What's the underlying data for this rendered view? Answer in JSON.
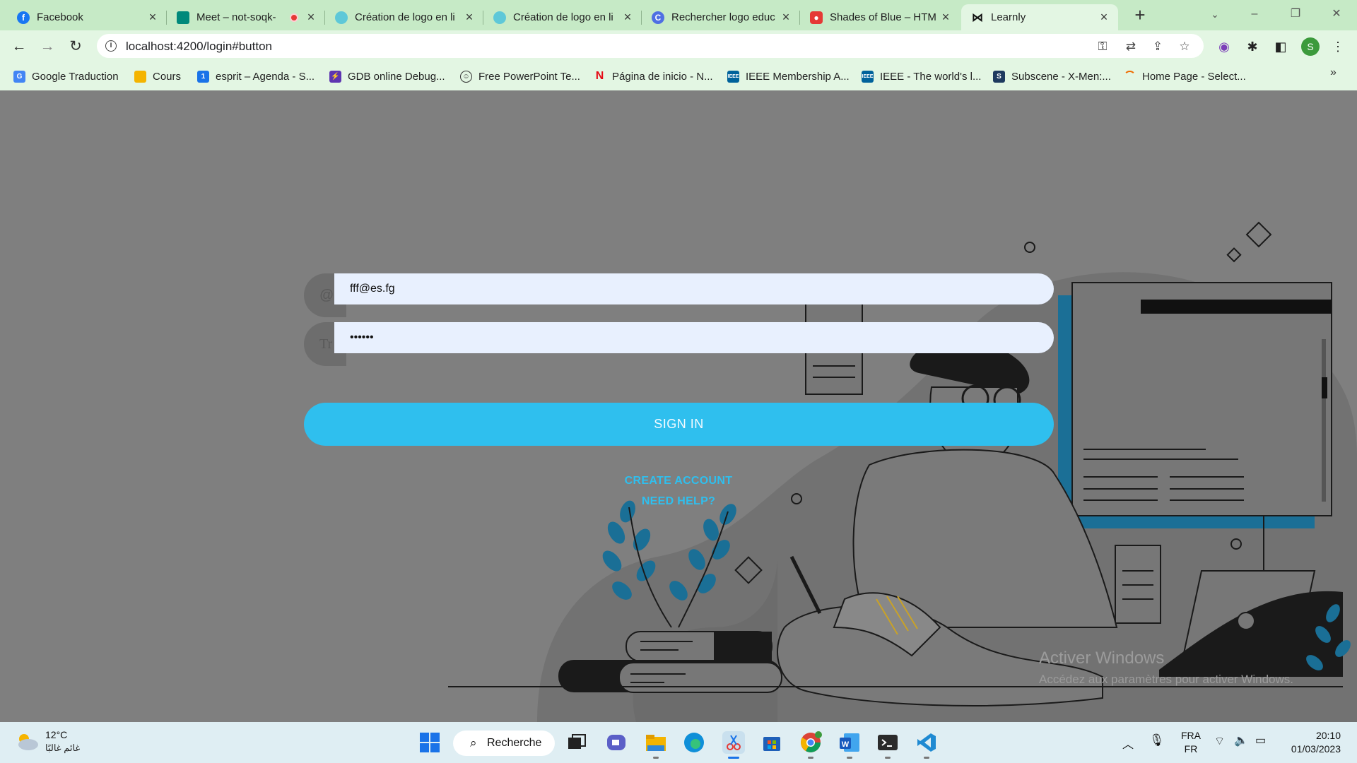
{
  "browser": {
    "tabs": [
      {
        "title": "Facebook",
        "favicon": "facebook-icon",
        "color": "#1877f2"
      },
      {
        "title": "Meet – not-soqk-",
        "favicon": "google-meet-icon",
        "color": "#00897b"
      },
      {
        "title": "Création de logo en li",
        "favicon": "logo-maker-icon",
        "color": "#5ec8d8"
      },
      {
        "title": "Création de logo en li",
        "favicon": "logo-maker-icon",
        "color": "#5ec8d8"
      },
      {
        "title": "Rechercher logo educ",
        "favicon": "canva-icon",
        "color": "#4f6fe3"
      },
      {
        "title": "Shades of Blue – HTM",
        "favicon": "shades-icon",
        "color": "#e53935"
      },
      {
        "title": "Learnly",
        "favicon": "learnly-icon",
        "color": "#111111"
      }
    ],
    "url": "localhost:4200/login#button",
    "bookmarks": [
      {
        "label": "Google Traduction",
        "icon": "translate-icon",
        "color": "#4285f4"
      },
      {
        "label": "Cours",
        "icon": "classroom-icon",
        "color": "#f4b400"
      },
      {
        "label": "esprit – Agenda - S...",
        "icon": "calendar-icon",
        "color": "#1a73e8"
      },
      {
        "label": "GDB online Debug...",
        "icon": "gdb-icon",
        "color": "#5e35b1"
      },
      {
        "label": "Free PowerPoint Te...",
        "icon": "smiley-icon",
        "color": "#333333"
      },
      {
        "label": "Página de inicio - N...",
        "icon": "netflix-icon",
        "color": "#e50914"
      },
      {
        "label": "IEEE Membership A...",
        "icon": "ieee-icon",
        "color": "#00629b"
      },
      {
        "label": "IEEE - The world's l...",
        "icon": "ieee-icon",
        "color": "#00629b"
      },
      {
        "label": "Subscene - X-Men:...",
        "icon": "subscene-icon",
        "color": "#1e3a5f"
      },
      {
        "label": "Home Page - Select...",
        "icon": "loader-icon",
        "color": "#ef6c00"
      }
    ],
    "profile_initial": "S"
  },
  "login": {
    "email_value": "fff@es.fg",
    "password_value": "••••••",
    "email_icon_text": "@",
    "password_icon_text": "Tr",
    "signin_label": "SIGN IN",
    "create_account_label": "CREATE ACCOUNT",
    "need_help_label": "NEED HELP?",
    "accent_color": "#2fbfee"
  },
  "watermark": {
    "title": "Activer Windows",
    "subtitle": "Accédez aux paramètres pour activer Windows."
  },
  "taskbar": {
    "temperature": "12°C",
    "weather": "غائم غالبًا",
    "search_label": "Recherche",
    "lang_top": "FRA",
    "lang_bottom": "FR",
    "time": "20:10",
    "date": "01/03/2023"
  }
}
